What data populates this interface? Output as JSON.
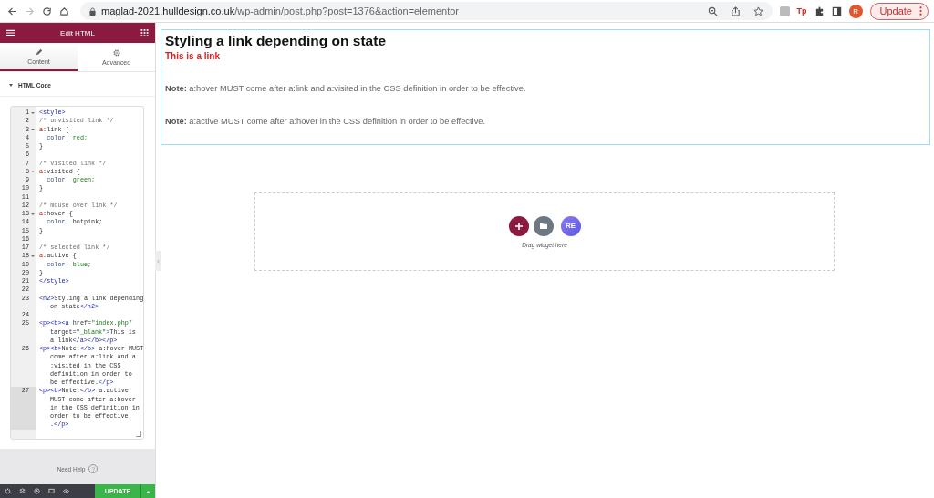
{
  "browser": {
    "url_host": "maglad-2021.hulldesign.co.uk",
    "url_path": "/wp-admin/post.php?post=1376&action=elementor",
    "extension_label": "Tp",
    "avatar_letter": "R",
    "update_button": "Update"
  },
  "panel": {
    "title": "Edit HTML",
    "tabs": [
      {
        "label": "Content",
        "selected": true
      },
      {
        "label": "Advanced",
        "selected": false
      }
    ],
    "section": {
      "label": "HTML Code",
      "expanded": true
    },
    "code_lines": [
      {
        "number": "1",
        "foldable": true,
        "active": false,
        "wraps": [
          {
            "spans": [
              {
                "kind": "tag",
                "text": "<style>"
              }
            ]
          }
        ]
      },
      {
        "number": "2",
        "foldable": false,
        "active": false,
        "wraps": [
          {
            "spans": [
              {
                "kind": "comment",
                "text": "/* unvisited link */"
              }
            ]
          }
        ]
      },
      {
        "number": "3",
        "foldable": true,
        "active": false,
        "wraps": [
          {
            "spans": [
              {
                "kind": "sel",
                "text": "a"
              },
              {
                "kind": "text",
                "text": ":link {"
              }
            ]
          }
        ]
      },
      {
        "number": "4",
        "foldable": false,
        "active": false,
        "wraps": [
          {
            "spans": [
              {
                "kind": "prop",
                "text": "  color:"
              },
              {
                "kind": "value",
                "text": " red;"
              }
            ]
          }
        ]
      },
      {
        "number": "5",
        "foldable": false,
        "active": false,
        "wraps": [
          {
            "spans": [
              {
                "kind": "text",
                "text": "}"
              }
            ]
          }
        ]
      },
      {
        "number": "6",
        "foldable": false,
        "active": false
      },
      {
        "number": "7",
        "foldable": false,
        "active": false,
        "wraps": [
          {
            "spans": [
              {
                "kind": "comment",
                "text": "/* visited link */"
              }
            ]
          }
        ]
      },
      {
        "number": "8",
        "foldable": true,
        "active": false,
        "wraps": [
          {
            "spans": [
              {
                "kind": "sel",
                "text": "a"
              },
              {
                "kind": "text",
                "text": ":visited {"
              }
            ]
          }
        ]
      },
      {
        "number": "9",
        "foldable": false,
        "active": false,
        "wraps": [
          {
            "spans": [
              {
                "kind": "prop",
                "text": "  color:"
              },
              {
                "kind": "value",
                "text": " green;"
              }
            ]
          }
        ]
      },
      {
        "number": "10",
        "foldable": false,
        "active": false,
        "wraps": [
          {
            "spans": [
              {
                "kind": "text",
                "text": "}"
              }
            ]
          }
        ]
      },
      {
        "number": "11",
        "foldable": false,
        "active": false
      },
      {
        "number": "12",
        "foldable": false,
        "active": false,
        "wraps": [
          {
            "spans": [
              {
                "kind": "comment",
                "text": "/* mouse over link */"
              }
            ]
          }
        ]
      },
      {
        "number": "13",
        "foldable": true,
        "active": false,
        "wraps": [
          {
            "spans": [
              {
                "kind": "sel",
                "text": "a"
              },
              {
                "kind": "text",
                "text": ":hover {"
              }
            ]
          }
        ]
      },
      {
        "number": "14",
        "foldable": false,
        "active": false,
        "wraps": [
          {
            "spans": [
              {
                "kind": "prop",
                "text": "  color:"
              },
              {
                "kind": "text",
                "text": " hotpink;"
              }
            ]
          }
        ]
      },
      {
        "number": "15",
        "foldable": false,
        "active": false,
        "wraps": [
          {
            "spans": [
              {
                "kind": "text",
                "text": "}"
              }
            ]
          }
        ]
      },
      {
        "number": "16",
        "foldable": false,
        "active": false
      },
      {
        "number": "17",
        "foldable": false,
        "active": false,
        "wraps": [
          {
            "spans": [
              {
                "kind": "comment",
                "text": "/* selected link */"
              }
            ]
          }
        ]
      },
      {
        "number": "18",
        "foldable": true,
        "active": false,
        "wraps": [
          {
            "spans": [
              {
                "kind": "sel",
                "text": "a"
              },
              {
                "kind": "text",
                "text": ":active {"
              }
            ]
          }
        ]
      },
      {
        "number": "19",
        "foldable": false,
        "active": false,
        "wraps": [
          {
            "spans": [
              {
                "kind": "prop",
                "text": "  color:"
              },
              {
                "kind": "value",
                "text": " blue;"
              }
            ]
          }
        ]
      },
      {
        "number": "20",
        "foldable": false,
        "active": false,
        "wraps": [
          {
            "spans": [
              {
                "kind": "text",
                "text": "}"
              }
            ]
          }
        ]
      },
      {
        "number": "21",
        "foldable": false,
        "active": false,
        "wraps": [
          {
            "spans": [
              {
                "kind": "tag",
                "text": "</style>"
              }
            ]
          }
        ]
      },
      {
        "number": "22",
        "foldable": false,
        "active": false
      },
      {
        "number": "23",
        "foldable": false,
        "active": false,
        "wraps": [
          {
            "spans": [
              {
                "kind": "tag",
                "text": "<h2>"
              },
              {
                "kind": "text",
                "text": "Styling a link depending"
              }
            ]
          },
          {
            "spans": [
              {
                "kind": "text",
                "text": "on state"
              },
              {
                "kind": "tag",
                "text": "</h2>"
              }
            ]
          }
        ]
      },
      {
        "number": "24",
        "foldable": false,
        "active": false
      },
      {
        "number": "25",
        "foldable": false,
        "active": false,
        "wraps": [
          {
            "spans": [
              {
                "kind": "tag",
                "text": "<p><b><a"
              },
              {
                "kind": "text",
                "text": " href="
              },
              {
                "kind": "string",
                "text": "\"index.php\""
              }
            ]
          },
          {
            "spans": [
              {
                "kind": "text",
                "text": "target="
              },
              {
                "kind": "string",
                "text": "\"_blank\""
              },
              {
                "kind": "tag",
                "text": ">"
              },
              {
                "kind": "text",
                "text": "This is"
              }
            ]
          },
          {
            "spans": [
              {
                "kind": "text",
                "text": "a link"
              },
              {
                "kind": "tag",
                "text": "</a></b></p>"
              }
            ]
          }
        ]
      },
      {
        "number": "26",
        "foldable": false,
        "active": false,
        "wraps": [
          {
            "spans": [
              {
                "kind": "tag",
                "text": "<p><b>"
              },
              {
                "kind": "text",
                "text": "Note:"
              },
              {
                "kind": "tag",
                "text": "</b>"
              },
              {
                "kind": "text",
                "text": " a:hover MUST"
              }
            ]
          },
          {
            "spans": [
              {
                "kind": "text",
                "text": "come after a:link and a"
              }
            ]
          },
          {
            "spans": [
              {
                "kind": "text",
                "text": ":visited in the CSS"
              }
            ]
          },
          {
            "spans": [
              {
                "kind": "text",
                "text": "definition in order to"
              }
            ]
          },
          {
            "spans": [
              {
                "kind": "text",
                "text": "be effective."
              },
              {
                "kind": "tag",
                "text": "</p>"
              }
            ]
          }
        ]
      },
      {
        "number": "27",
        "foldable": false,
        "active": true,
        "wraps": [
          {
            "spans": [
              {
                "kind": "tag",
                "text": "<p><b>"
              },
              {
                "kind": "text",
                "text": "Note:"
              },
              {
                "kind": "tag",
                "text": "</b>"
              },
              {
                "kind": "text",
                "text": " a:active"
              }
            ]
          },
          {
            "spans": [
              {
                "kind": "text",
                "text": "MUST come after a:hover"
              }
            ]
          },
          {
            "spans": [
              {
                "kind": "text",
                "text": "in the CSS definition in"
              }
            ]
          },
          {
            "spans": [
              {
                "kind": "text",
                "text": "order to be effective"
              }
            ]
          },
          {
            "spans": [
              {
                "kind": "text",
                "text": "."
              },
              {
                "kind": "tag",
                "text": "</p>"
              }
            ]
          }
        ]
      }
    ],
    "help": "Need Help",
    "help_icon": "?",
    "update_button": "UPDATE"
  },
  "preview": {
    "heading": "Styling a link depending on state",
    "link": "This is a link",
    "notes": [
      "**Note:** a:hover MUST come after a:link and a:visited in the CSS definition in order to be effective.",
      "**Note:** a:active MUST come after a:hover in the CSS definition in order to be effective."
    ]
  },
  "dropzone": {
    "logo_text": "RE",
    "hint": "Drag widget here"
  }
}
